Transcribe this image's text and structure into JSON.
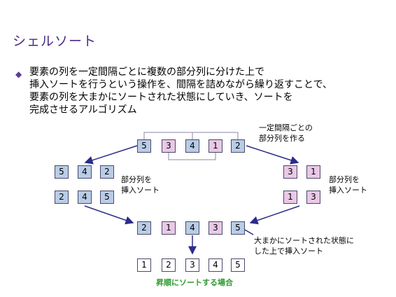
{
  "title": "シェルソート",
  "bullet_icon": "diamond-bullet-icon",
  "body_lines": [
    "要素の列を一定間隔ごとに複数の部分列に分けた上で",
    "挿入ソートを行うという操作を、間隔を詰めながら繰り返すことで、",
    "要素の列を大まかにソートされた状態にしていき、ソートを",
    "完成させるアルゴリズム"
  ],
  "diagram": {
    "top_row": [
      "5",
      "3",
      "4",
      "1",
      "2"
    ],
    "left_before": [
      "5",
      "4",
      "2"
    ],
    "left_after": [
      "2",
      "4",
      "5"
    ],
    "right_before": [
      "3",
      "1"
    ],
    "right_after": [
      "1",
      "3"
    ],
    "middle_row": [
      "2",
      "1",
      "4",
      "3",
      "5"
    ],
    "final_row": [
      "1",
      "2",
      "3",
      "4",
      "5"
    ],
    "label_split": [
      "一定間隔ごとの",
      "部分列を作る"
    ],
    "label_left_sort": [
      "部分列を",
      "挿入ソート"
    ],
    "label_right_sort": [
      "部分列を",
      "挿入ソート"
    ],
    "label_rough": [
      "大まかにソートされた状態に",
      "した上で挿入ソート"
    ],
    "caption": "昇順にソートする場合"
  },
  "colors": {
    "title": "#4b2a8a",
    "blue_box": "#b9cce6",
    "pink_box": "#e9c8e6",
    "arrow": "#2b2b8a",
    "caption": "#2f9b2f"
  }
}
